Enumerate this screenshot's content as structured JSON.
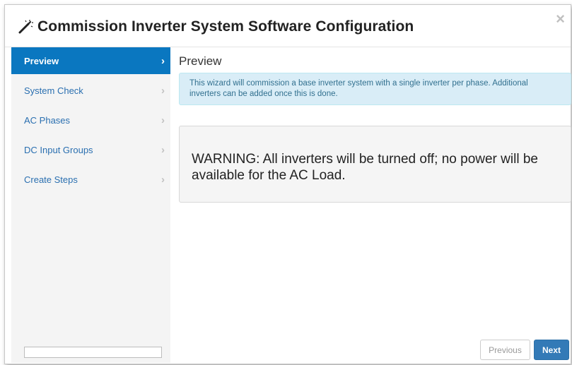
{
  "dialog": {
    "title": "Commission Inverter System Software Configuration",
    "title_icon": "magic-wand-icon",
    "close_label": "×"
  },
  "sidebar": {
    "steps": [
      {
        "label": "Preview",
        "active": true
      },
      {
        "label": "System Check",
        "active": false
      },
      {
        "label": "AC Phases",
        "active": false
      },
      {
        "label": "DC Input Groups",
        "active": false
      },
      {
        "label": "Create Steps",
        "active": false
      }
    ],
    "chevron": "›",
    "input_value": ""
  },
  "content": {
    "title": "Preview",
    "info": "This wizard will commission a base inverter system with a single inverter per phase. Additional inverters can be added once this is done.",
    "warning": "WARNING: All inverters will be turned off; no power will be available for the AC Load."
  },
  "footer": {
    "previous_label": "Previous",
    "next_label": "Next"
  },
  "colors": {
    "active_step_bg": "#0a77c0",
    "step_link": "#2a6fb0",
    "info_bg": "#d9edf7",
    "info_text": "#31708f",
    "primary_button": "#337ab7"
  }
}
